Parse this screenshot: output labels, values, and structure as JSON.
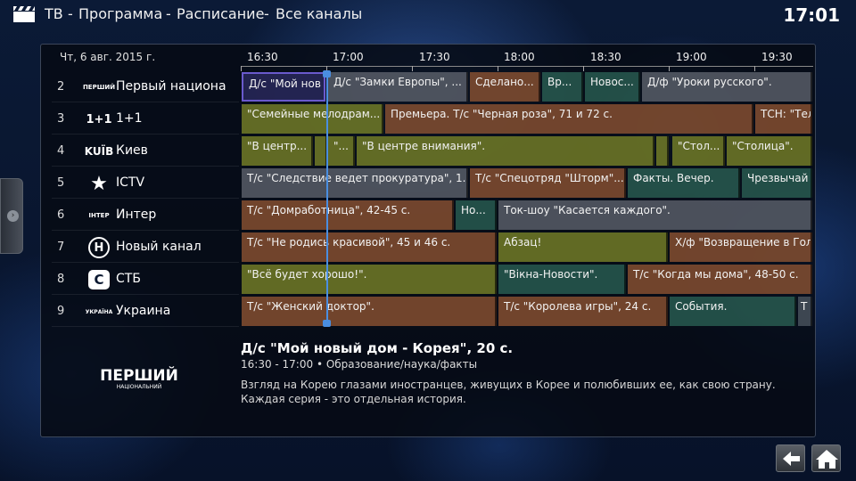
{
  "header": {
    "crumbs": [
      "ТВ",
      "Программа",
      "Расписание",
      "Все каналы"
    ],
    "separator": "-",
    "clock": "17:01"
  },
  "guide": {
    "date": "Чт, 6 авг. 2015 г.",
    "times": [
      "16:30",
      "17:00",
      "17:30",
      "18:00",
      "18:30",
      "19:00",
      "19:30"
    ]
  },
  "channels": [
    {
      "num": "2",
      "name": "Первый национа",
      "logo_text": "ПЕРШИЙ"
    },
    {
      "num": "3",
      "name": "1+1",
      "logo_text": "1+1"
    },
    {
      "num": "4",
      "name": "Киев",
      "logo_text": "KUÏB"
    },
    {
      "num": "5",
      "name": "ICTV",
      "logo_text": "★"
    },
    {
      "num": "6",
      "name": "Интер",
      "logo_text": "ІНТЕР"
    },
    {
      "num": "7",
      "name": "Новый канал",
      "logo_text": "Н"
    },
    {
      "num": "8",
      "name": "СТБ",
      "logo_text": "C"
    },
    {
      "num": "9",
      "name": "Украина",
      "logo_text": "УКРАЇНА"
    }
  ],
  "programs": [
    [
      {
        "t": "Д/с \"Мой нов",
        "c": "purple"
      },
      {
        "t": "Д/с \"Замки Европы\", ...",
        "c": "gray"
      },
      {
        "t": "Сделано...",
        "c": "brown"
      },
      {
        "t": "Вр...",
        "c": "teal"
      },
      {
        "t": "Новос...",
        "c": "teal"
      },
      {
        "t": "Д/ф \"Уроки русского\".",
        "c": "gray"
      }
    ],
    [
      {
        "t": "\"Семейные мелодрам...",
        "c": "olive"
      },
      {
        "t": "Премьера. Т/с \"Черная роза\", 71 и 72 с.",
        "c": "brown"
      },
      {
        "t": "ТСН: \"Тел",
        "c": "brown"
      }
    ],
    [
      {
        "t": "\"В центр...",
        "c": "olive"
      },
      {
        "t": "",
        "c": "olive"
      },
      {
        "t": "\"...",
        "c": "olive"
      },
      {
        "t": "\"В центре внимания\".",
        "c": "olive"
      },
      {
        "t": "",
        "c": "olive"
      },
      {
        "t": "\"Стол...",
        "c": "olive"
      },
      {
        "t": "\"Столица\".",
        "c": "olive"
      }
    ],
    [
      {
        "t": "Т/с \"Следствие ведет прокуратура\", 1...",
        "c": "gray"
      },
      {
        "t": "Т/с \"Спецотряд \"Шторм\"...",
        "c": "brown"
      },
      {
        "t": "Факты. Вечер.",
        "c": "teal"
      },
      {
        "t": "Чрезвычай",
        "c": "teal"
      }
    ],
    [
      {
        "t": "Т/с \"Домработница\", 42-45 с.",
        "c": "brown"
      },
      {
        "t": "Но...",
        "c": "teal"
      },
      {
        "t": "Ток-шоу \"Касается каждого\".",
        "c": "gray"
      }
    ],
    [
      {
        "t": "Т/с \"Не родись красивой\", 45 и 46 с.",
        "c": "brown"
      },
      {
        "t": "Абзац!",
        "c": "olive"
      },
      {
        "t": "Х/ф \"Возвращение в Гол",
        "c": "brown"
      }
    ],
    [
      {
        "t": "\"Всё будет хорошо!\".",
        "c": "olive"
      },
      {
        "t": "\"Вікна-Новости\".",
        "c": "teal"
      },
      {
        "t": "Т/с \"Когда мы дома\", 48-50 с.",
        "c": "brown"
      }
    ],
    [
      {
        "t": "Т/с \"Женский доктор\".",
        "c": "brown"
      },
      {
        "t": "Т/с \"Королева игры\", 24 с.",
        "c": "brown"
      },
      {
        "t": "События.",
        "c": "teal"
      },
      {
        "t": "Т",
        "c": "slate"
      }
    ]
  ],
  "detail": {
    "title": "Д/с \"Мой новый дом - Корея\", 20 с.",
    "meta": "16:30 - 17:00 • Образование/наука/факты",
    "description": "Взгляд на Корею глазами иностранцев, живущих в Корее и полюбивших ее, как свою страну. Каждая серия - это отдельная история.",
    "logo_main": "ПЕРШИЙ",
    "logo_sub": "НАЦІОНАЛЬНИЙ"
  },
  "icons": {
    "back": "back-arrow-icon",
    "home": "home-icon",
    "app": "clapperboard-icon",
    "side": "side-menu-icon"
  }
}
